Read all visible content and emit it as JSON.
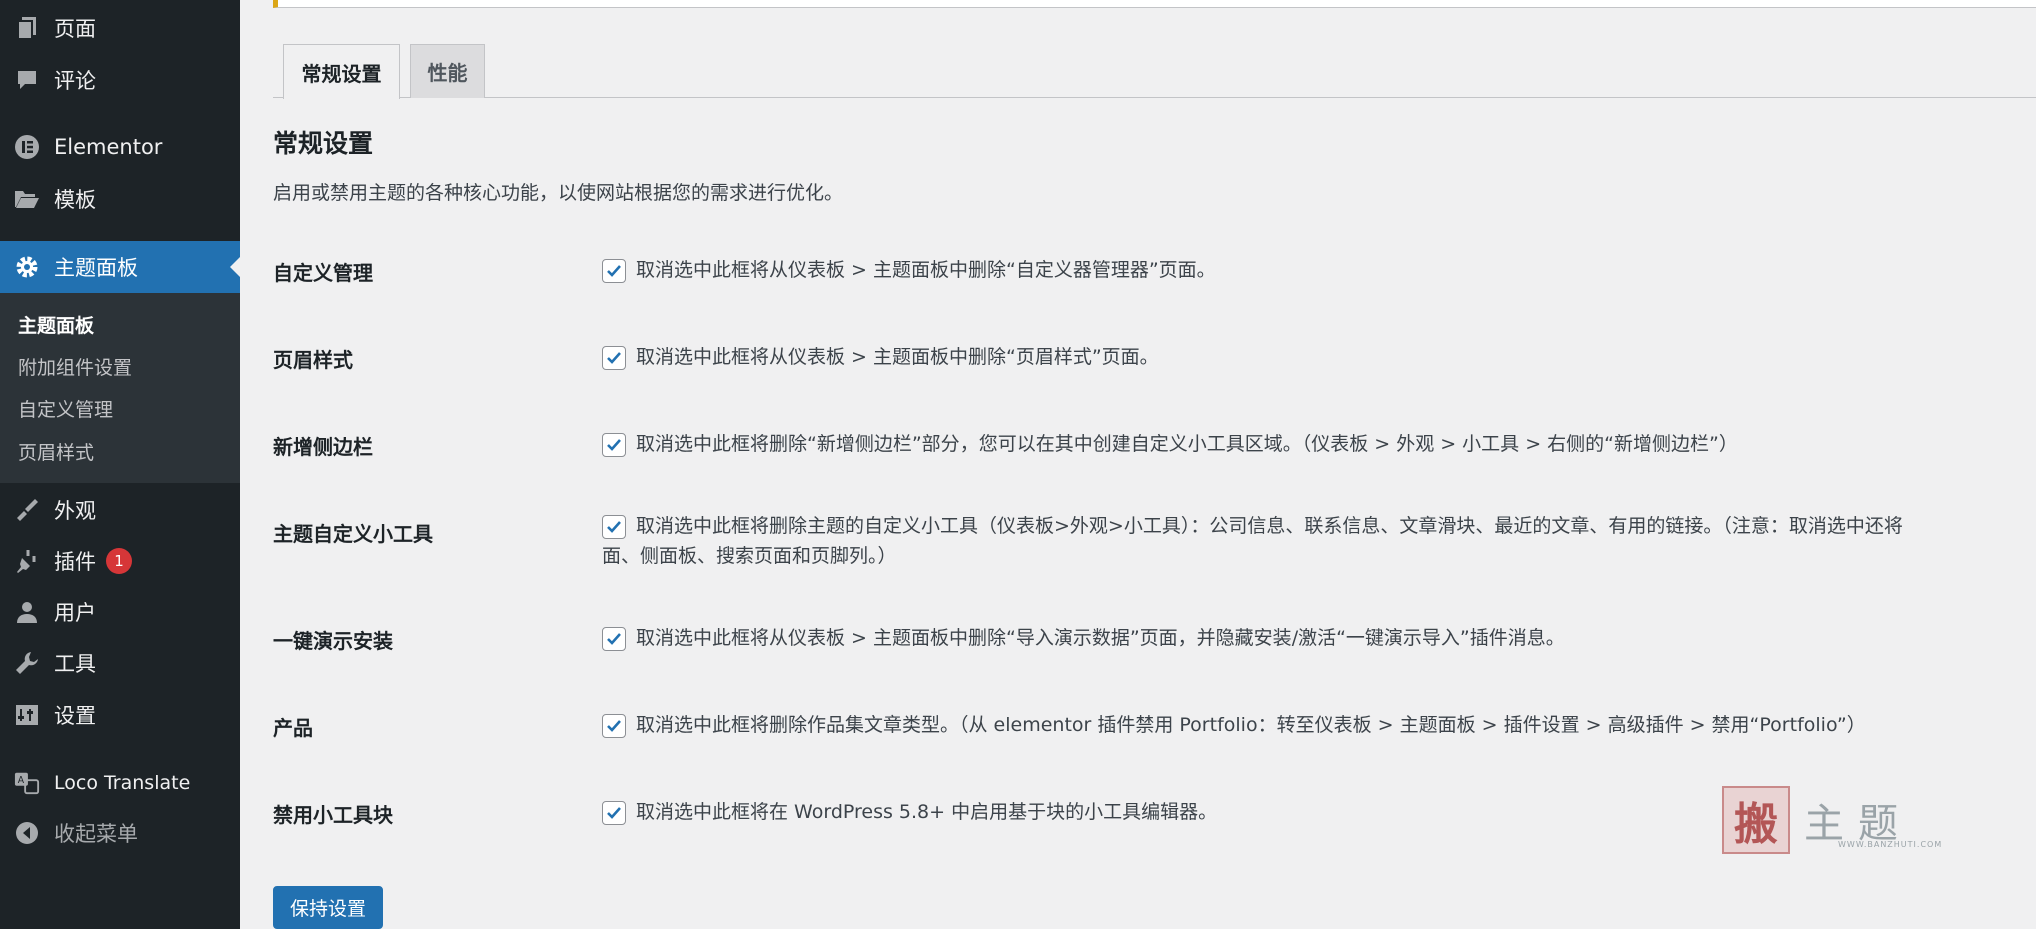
{
  "sidebar": {
    "items": [
      {
        "label": "页面",
        "icon": "page-icon"
      },
      {
        "label": "评论",
        "icon": "comment-icon"
      },
      {
        "label": "Elementor",
        "icon": "elementor-icon"
      },
      {
        "label": "模板",
        "icon": "folder-icon"
      },
      {
        "label": "主题面板",
        "icon": "gear-icon"
      },
      {
        "label": "外观",
        "icon": "brush-icon"
      },
      {
        "label": "插件",
        "icon": "plugin-icon",
        "badge": "1"
      },
      {
        "label": "用户",
        "icon": "user-icon"
      },
      {
        "label": "工具",
        "icon": "wrench-icon"
      },
      {
        "label": "设置",
        "icon": "sliders-icon"
      },
      {
        "label": "Loco Translate",
        "icon": "translate-icon"
      },
      {
        "label": "收起菜单",
        "icon": "collapse-icon"
      }
    ],
    "submenu": [
      "主题面板",
      "附加组件设置",
      "自定义管理",
      "页眉样式"
    ]
  },
  "tabs": [
    {
      "label": "常规设置",
      "active": true
    },
    {
      "label": "性能",
      "active": false
    }
  ],
  "section": {
    "title": "常规设置",
    "description": "启用或禁用主题的各种核心功能，以使网站根据您的需求进行优化。"
  },
  "rows": [
    {
      "label": "自定义管理",
      "checked": true,
      "text": "取消选中此框将从仪表板 > 主题面板中删除“自定义器管理器”页面。"
    },
    {
      "label": "页眉样式",
      "checked": true,
      "text": "取消选中此框将从仪表板 > 主题面板中删除“页眉样式”页面。"
    },
    {
      "label": "新增侧边栏",
      "checked": true,
      "text": "取消选中此框将删除“新增侧边栏”部分，您可以在其中创建自定义小工具区域。（仪表板 > 外观 > 小工具 > 右侧的“新增侧边栏”）"
    },
    {
      "label": "主题自定义小工具",
      "checked": true,
      "text": "取消选中此框将删除主题的自定义小工具（仪表板>外观>小工具）：公司信息、联系信息、文章滑块、最近的文章、有用的链接。（注意：取消选中还将",
      "text2": "面、侧面板、搜索页面和页脚列。）"
    },
    {
      "label": "一键演示安装",
      "checked": true,
      "text": "取消选中此框将从仪表板 > 主题面板中删除“导入演示数据”页面，并隐藏安装/激活“一键演示导入”插件消息。"
    },
    {
      "label": "产品",
      "checked": true,
      "text": "取消选中此框将删除作品集文章类型。（从 elementor 插件禁用 Portfolio：转至仪表板 > 主题面板 > 插件设置 > 高级插件 > 禁用“Portfolio”）"
    },
    {
      "label": "禁用小工具块",
      "checked": true,
      "text": "取消选中此框将在 WordPress 5.8+ 中启用基于块的小工具编辑器。"
    }
  ],
  "save_label": "保持设置",
  "watermark": {
    "seal": "搬",
    "text": "主题",
    "url": "WWW.BANZHUTI.COM"
  },
  "colors": {
    "accent": "#2271b1",
    "sidebar": "#1d2327",
    "badge": "#d63638"
  }
}
